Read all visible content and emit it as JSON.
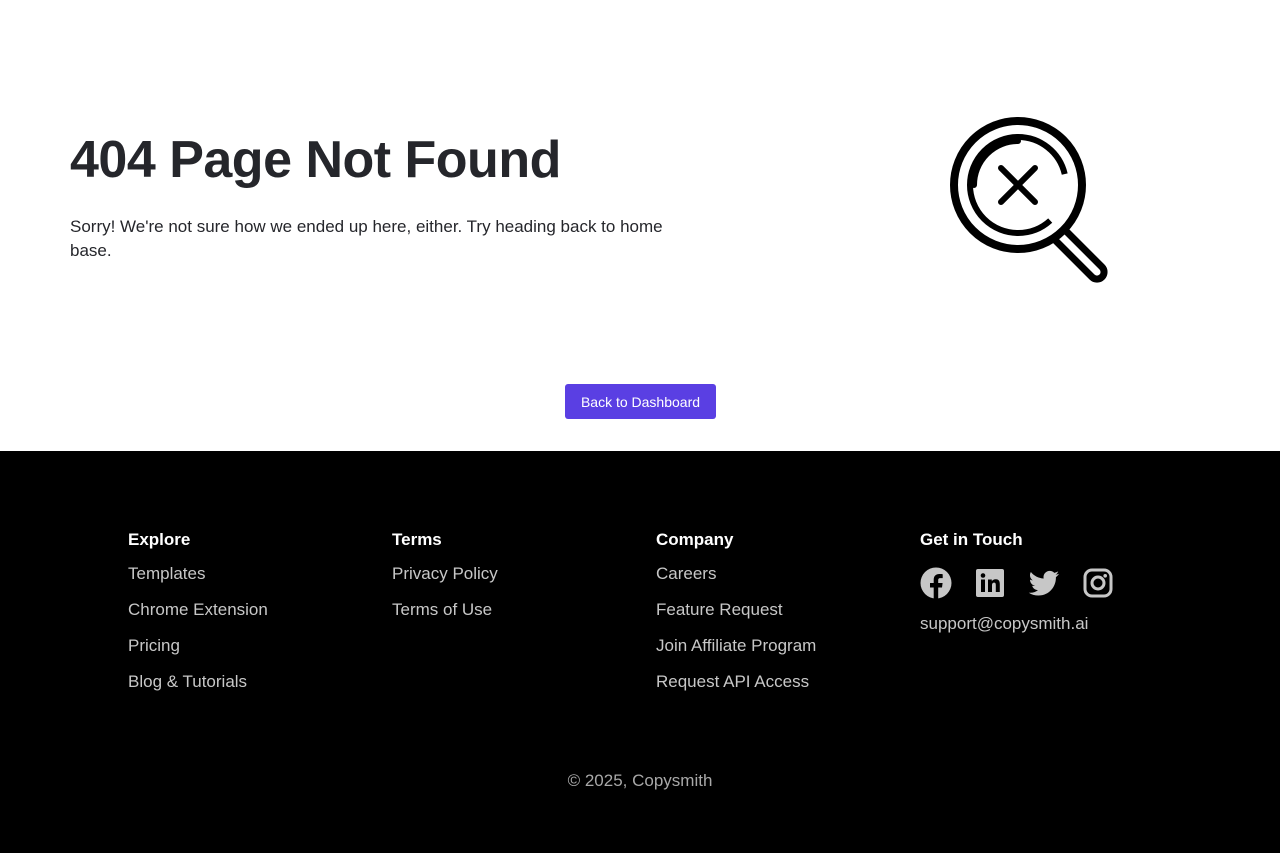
{
  "hero": {
    "title": "404 Page Not Found",
    "message": "Sorry! We're not sure how we ended up here, either. Try heading back to home base.",
    "illustration_icon": "magnifier-x-icon",
    "button_label": "Back to Dashboard",
    "button_color": "#5a3fe3"
  },
  "footer": {
    "explore": {
      "heading": "Explore",
      "links": [
        "Templates",
        "Chrome Extension",
        "Pricing",
        "Blog & Tutorials"
      ]
    },
    "terms": {
      "heading": "Terms",
      "links": [
        "Privacy Policy",
        "Terms of Use"
      ]
    },
    "company": {
      "heading": "Company",
      "links": [
        "Careers",
        "Feature Request",
        "Join Affiliate Program",
        "Request API Access"
      ]
    },
    "contact": {
      "heading": "Get in Touch",
      "social_icons": [
        "facebook-icon",
        "linkedin-icon",
        "twitter-icon",
        "instagram-icon"
      ],
      "email": "support@copysmith.ai"
    },
    "copyright": "© 2025, Copysmith"
  },
  "colors": {
    "footer_background": "#000000",
    "footer_link": "#c7c7c7",
    "heading_text": "#25262b"
  }
}
